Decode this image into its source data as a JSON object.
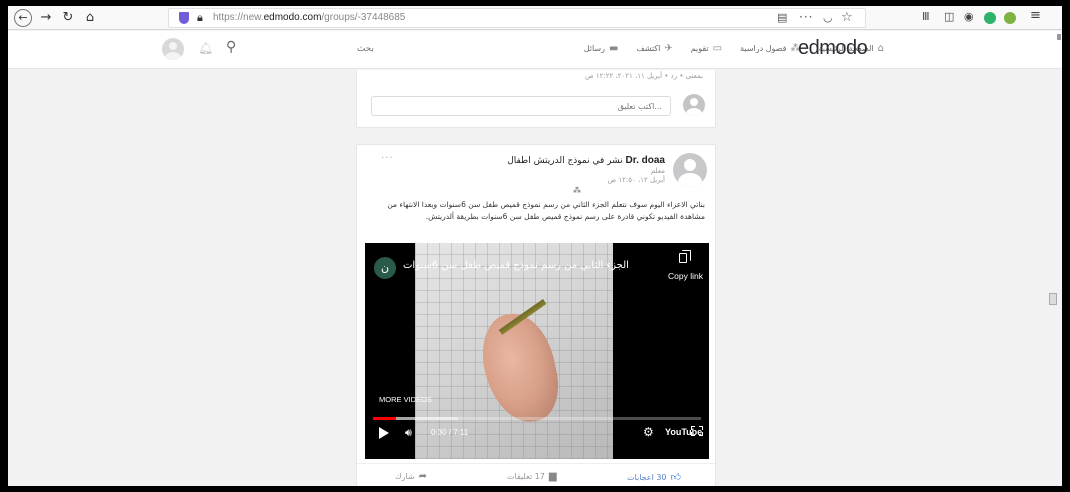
{
  "browser": {
    "url_prefix": "https://new.",
    "url_domain": "edmodo.com",
    "url_path": "/groups/-37448685"
  },
  "header": {
    "logo": "edmodo",
    "search_placeholder": "بحث",
    "nav": [
      "الصفحة الرئيسية",
      "فصول دراسية",
      "تقويم",
      "اكتشف",
      "رسائل"
    ]
  },
  "prev_post": {
    "meta": "بمعنى • رد • أبريل ١١، ٢٠٢١، ١٢:٢٢ ص",
    "comment_placeholder": "اكتب تعليق..."
  },
  "post": {
    "menu": "···",
    "author": "Dr. doaa",
    "title_suffix": "نشر في نموذج الدريتش اطفال",
    "role": "معلم",
    "date": "أبريل ١٢، ١٢:٥٠ ص",
    "body": "بناتي الاعزاء اليوم سوف نتعلم الجزء الثاني من رسم نموذج قميص طفل سن 6سنوات وبعدا الانتهاء من مشاهدة الفيديو تكوني قادرة على رسم نموذج قميص طفل سن 6سنوات بطريقة ألدريتش.",
    "video": {
      "channel_initial": "ن",
      "title": "الجزء الثاني من رسم نموذج قميص طفل سن 6سنوات",
      "copy_link": "Copy link",
      "more_videos": "MORE VIDEOS",
      "time": "0:30 / 7:11",
      "progress_fraction": 0.07,
      "buffer_fraction": 0.26,
      "brand": "YouTube"
    },
    "footer": {
      "likes": "30 اعجابات",
      "comments": "17 تعليقات",
      "share": "شارك"
    }
  },
  "colors": {
    "like_blue": "#3b6fcf",
    "progress_red": "#ff0000",
    "shield_purple": "#6e5cd9"
  }
}
